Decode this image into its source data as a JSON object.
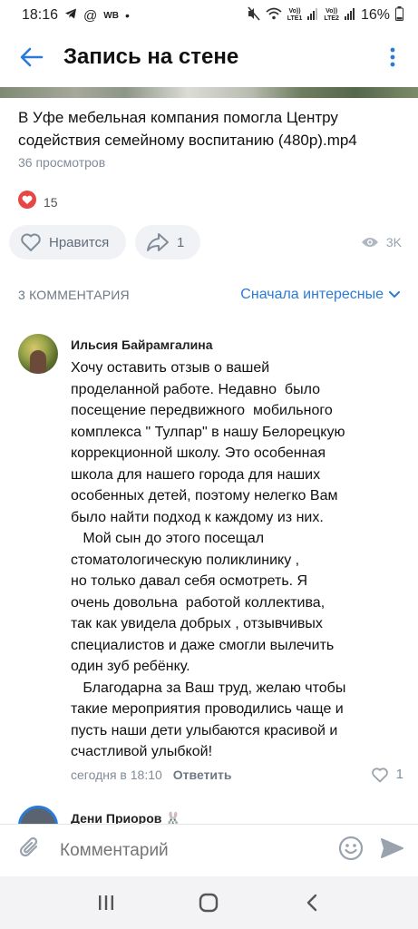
{
  "status": {
    "time": "18:16",
    "left_label": "WB",
    "net1": "LTE1",
    "net2": "LTE2",
    "volte": "Vo))",
    "battery": "16%"
  },
  "header": {
    "title": "Запись на стене"
  },
  "post": {
    "title": "В Уфе мебельная компания помогла Центру содействия семейному воспитанию (480p).mp4",
    "views": "36 просмотров",
    "reaction_count": "15",
    "like_label": "Нравится",
    "share_count": "1",
    "views_short": "3K"
  },
  "comments_header": {
    "count_label": "3 КОММЕНТАРИЯ",
    "sort_label": "Сначала интересные"
  },
  "comment": {
    "author": "Ильсия Байрамгалина",
    "text": "Хочу оставить отзыв о вашей\nпроделанной работе. Недавно  было\nпосещение передвижного  мобильного\nкомплекса \" Тулпар\" в нашу Белорецкую\nкоррекционной школу. Это особенная\nшкола для нашего города для наших\nособенных детей, поэтому нелегко Вам\nбыло найти подход к каждому из них.\n   Мой сын до этого посещал\nстоматологическую поликлинику ,\nно только давал себя осмотреть. Я\nочень довольна  работой коллектива,\nтак как увидела добрых , отзывчивых\nспециалистов и даже смогли вылечить\nодин зуб ребёнку.\n   Благодарна за Ваш труд, желаю чтобы\nтакие мероприятия проводились чаще и\nпусть наши дети улыбаются красивой и\nсчастливой улыбкой!",
    "time": "сегодня в 18:10",
    "reply_label": "Ответить",
    "likes": "1"
  },
  "next_comment": {
    "author": "Дени Приоров",
    "emoji": "🐰"
  },
  "input": {
    "placeholder": "Комментарий"
  },
  "colors": {
    "accent": "#2a7ad8",
    "heart": "#e64646",
    "secondary_text": "#818c99"
  },
  "icons": [
    "back-arrow-icon",
    "more-vertical-icon",
    "heart-icon",
    "like-outline-icon",
    "share-icon",
    "eye-icon",
    "chevron-down-icon",
    "attach-icon",
    "emoji-icon",
    "send-icon",
    "recents-icon",
    "home-icon",
    "back-nav-icon"
  ]
}
